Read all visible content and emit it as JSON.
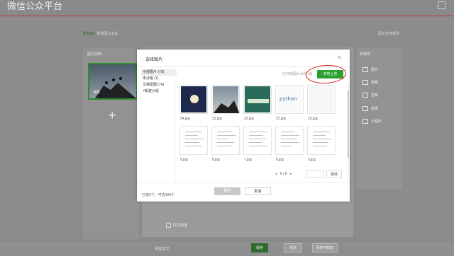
{
  "app": {
    "title": "微信公众平台"
  },
  "breadcrumb": {
    "root": "素材库",
    "sep": "/",
    "current": "新建图文消息"
  },
  "help": {
    "label": "图文发表帮助"
  },
  "left_panel": {
    "title": "图文列表",
    "article_label": "背影",
    "add_symbol": "+"
  },
  "right_panel": {
    "title": "多媒体",
    "items": [
      {
        "icon": "image-icon",
        "label": "图片"
      },
      {
        "icon": "video-icon",
        "label": "视频"
      },
      {
        "icon": "audio-icon",
        "label": "音频"
      },
      {
        "icon": "poll-icon",
        "label": "投票"
      },
      {
        "icon": "link-icon",
        "label": "小程序"
      }
    ]
  },
  "original": {
    "label": "原文链接"
  },
  "bottom_bar": {
    "collapse": "收起正文",
    "save": "保存",
    "preview": "预览",
    "publish": "保存并群发"
  },
  "modal": {
    "title": "选择图片",
    "close": "×",
    "groups": [
      {
        "label": "全部图片 (79)",
        "active": true
      },
      {
        "label": "未分组 (1)"
      },
      {
        "label": "文章配图 (74)"
      },
      {
        "label": "+新建分组"
      }
    ],
    "watermark_label": "已开启图片水印",
    "upload_label": "本地上传",
    "tiles": [
      {
        "name": "24.jpg",
        "kind": "photo"
      },
      {
        "name": "23.jpg",
        "kind": "photo"
      },
      {
        "name": "22.jpg",
        "kind": "photo"
      },
      {
        "name": "21.jpg",
        "kind": "photo",
        "text": "python"
      },
      {
        "name": "10.jpg",
        "kind": "doc"
      },
      {
        "name": "9.jpg",
        "kind": "doc"
      },
      {
        "name": "8.jpg",
        "kind": "doc"
      },
      {
        "name": "7.jpg",
        "kind": "doc"
      },
      {
        "name": "6.jpg",
        "kind": "doc"
      },
      {
        "name": "5.jpg",
        "kind": "doc"
      }
    ],
    "pager": {
      "prev": "◂",
      "current": "6 / 8",
      "next": "▸",
      "jump": "跳转"
    },
    "selected_info": "已选0个，可选100个",
    "ok": "确定",
    "cancel": "取消"
  },
  "colors": {
    "accent": "#2da130",
    "annotation": "#d81c1c"
  }
}
